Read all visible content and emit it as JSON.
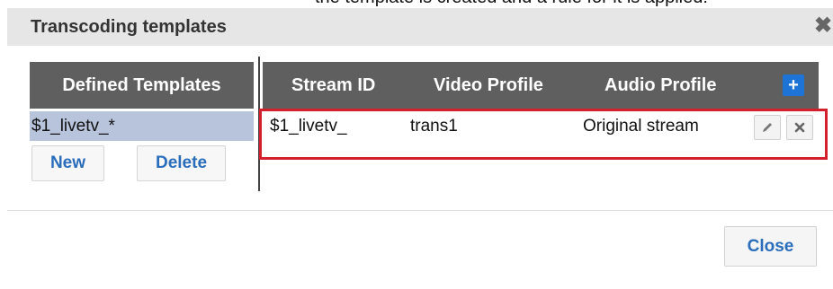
{
  "dialog": {
    "clipped_top_text": "the template is created and a rule for it is applied:",
    "title": "Transcoding templates",
    "close_icon": "close-icon"
  },
  "templates_panel": {
    "header": "Defined Templates",
    "items": [
      "$1_livetv_*"
    ],
    "new_label": "New",
    "delete_label": "Delete"
  },
  "rules_table": {
    "columns": [
      "Stream ID",
      "Video Profile",
      "Audio Profile"
    ],
    "add_icon": "plus-icon",
    "rows": [
      {
        "stream_id": "$1_livetv_",
        "video_profile": "trans1",
        "audio_profile": "Original stream"
      }
    ],
    "row_icons": [
      "pencil-icon",
      "close-icon"
    ]
  },
  "footer": {
    "close_label": "Close"
  },
  "colors": {
    "header_bg": "#5f5f5f",
    "selected_row": "#b8c4dc",
    "link_blue": "#2a6ebb",
    "add_blue": "#1e74d6",
    "highlight_red": "#d41f2c"
  }
}
